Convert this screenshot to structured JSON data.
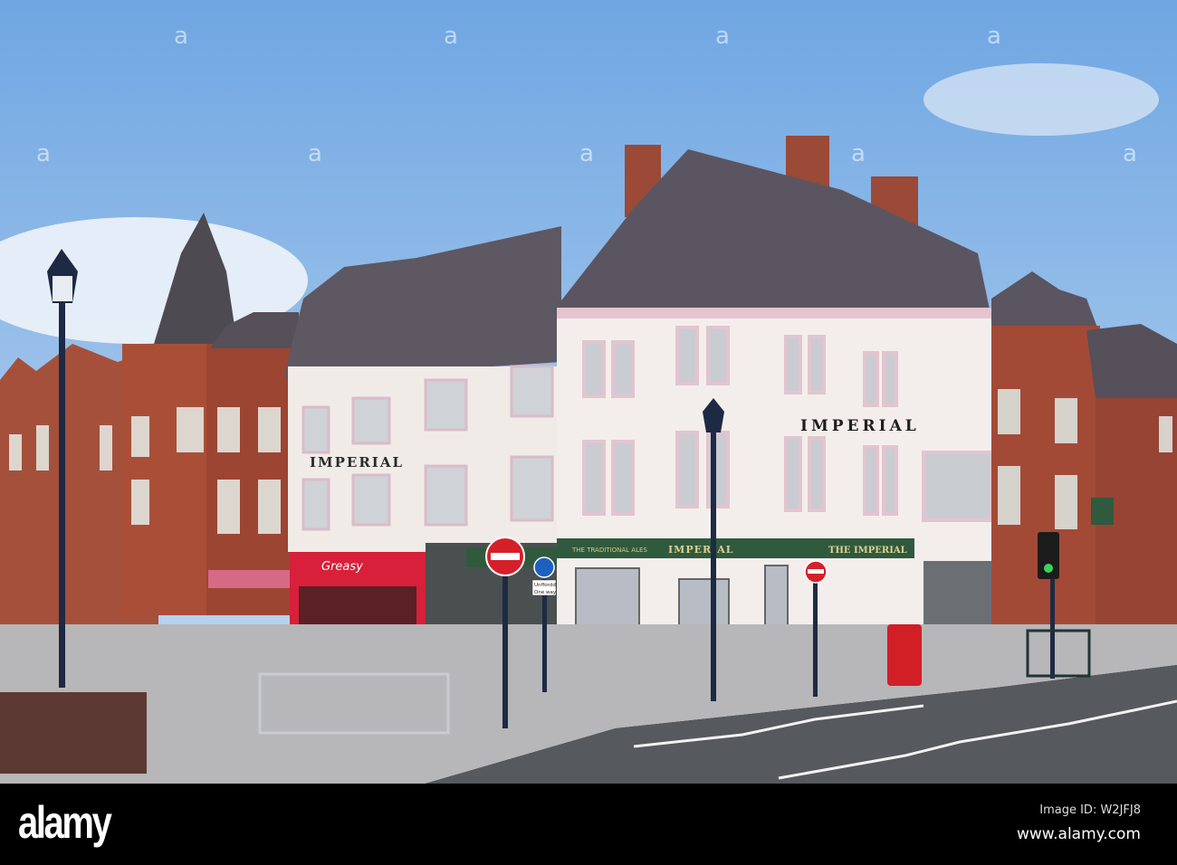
{
  "scene": {
    "signs": {
      "building_name_main": "IMPERIAL",
      "building_name_left": "IMPERIAL",
      "fascia_center": "IMPERIAL",
      "fascia_right": "THE IMPERIAL",
      "fascia_small": "THE TRADITIONAL ALES",
      "cafe_sign": "Greasy",
      "street_sign_line1": "Unffordd",
      "street_sign_line2": "One way"
    },
    "colors": {
      "sky": "#7fb0e6",
      "white_building": "#f2ecea",
      "pink_trim": "#e8c9d2",
      "brick": "#a44a35",
      "roof": "#5a5560",
      "road": "#55585c",
      "pavement": "#b9b9bb",
      "fascia_green": "#2f5a3e",
      "cafe_red": "#d8203a"
    }
  },
  "watermark": {
    "logo": "alamy",
    "image_id": "Image ID: W2JFJ8",
    "url": "www.alamy.com"
  }
}
